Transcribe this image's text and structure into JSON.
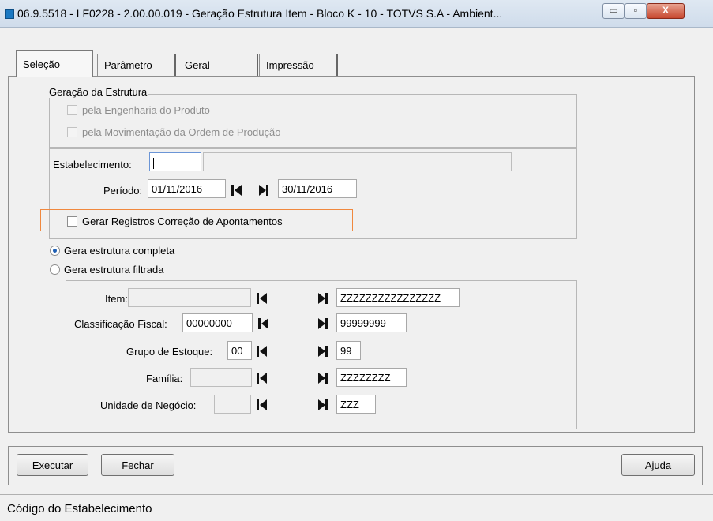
{
  "window": {
    "title": "06.9.5518 - LF0228 - 2.00.00.019 - Geração Estrutura Item - Bloco K - 10 - TOTVS S.A - Ambient...",
    "min_glyph": "▭",
    "max_glyph": "▫",
    "close_glyph": "X"
  },
  "tabs": [
    {
      "label": "Seleção",
      "active": true
    },
    {
      "label": "Parâmetro",
      "active": false
    },
    {
      "label": "Geral",
      "active": false
    },
    {
      "label": "Impressão",
      "active": false
    }
  ],
  "geracao": {
    "legend": "Geração da Estrutura",
    "opt_engenharia": "pela Engenharia do Produto",
    "opt_movimentacao": "pela Movimentação da Ordem de Produção"
  },
  "estab": {
    "label": "Estabelecimento:",
    "value": "",
    "description": ""
  },
  "periodo": {
    "label": "Período:",
    "start": "01/11/2016",
    "end": "30/11/2016"
  },
  "gerar_registros": {
    "label": "Gerar Registros Correção de Apontamentos",
    "checked": false
  },
  "estrutura": {
    "completa_label": "Gera estrutura completa",
    "filtrada_label": "Gera estrutura filtrada",
    "selected": "completa"
  },
  "filtros": {
    "item_label": "Item:",
    "item_start": "",
    "item_end": "ZZZZZZZZZZZZZZZZ",
    "classificacao_label": "Classificação Fiscal:",
    "classificacao_start": "00000000",
    "classificacao_end": "99999999",
    "grupo_label": "Grupo de Estoque:",
    "grupo_start": "00",
    "grupo_end": "99",
    "familia_label": "Família:",
    "familia_start": "",
    "familia_end": "ZZZZZZZZ",
    "unidade_label": "Unidade de Negócio:",
    "unidade_start": "",
    "unidade_end": "ZZZ"
  },
  "buttons": {
    "executar": "Executar",
    "fechar": "Fechar",
    "ajuda": "Ajuda"
  },
  "status": {
    "text": "Código do Estabelecimento"
  },
  "colors": {
    "highlight_border": "#f0883e",
    "radio_dot": "#1e5fb4"
  }
}
